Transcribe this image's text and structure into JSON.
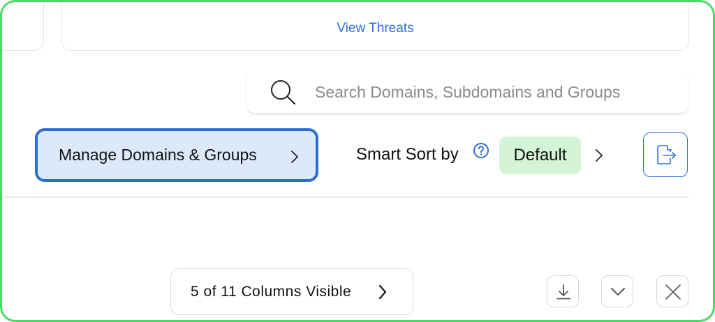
{
  "top_card": {
    "link_label": "View Threats"
  },
  "search": {
    "placeholder": "Search Domains, Subdomains and Groups",
    "value": ""
  },
  "toolbar": {
    "manage_label": "Manage Domains & Groups",
    "smart_sort_label": "Smart Sort by",
    "sort_value": "Default"
  },
  "footer": {
    "columns_label": "5 of 11 Columns Visible"
  },
  "colors": {
    "frame_border": "#4cd964",
    "accent_blue": "#2f6fd6",
    "manage_bg": "#dde9fb",
    "default_badge_bg": "#d3f5d6"
  },
  "icons": [
    "search-icon",
    "chevron-right-icon",
    "help-icon",
    "export-icon",
    "download-icon",
    "chevron-down-icon",
    "close-icon"
  ]
}
